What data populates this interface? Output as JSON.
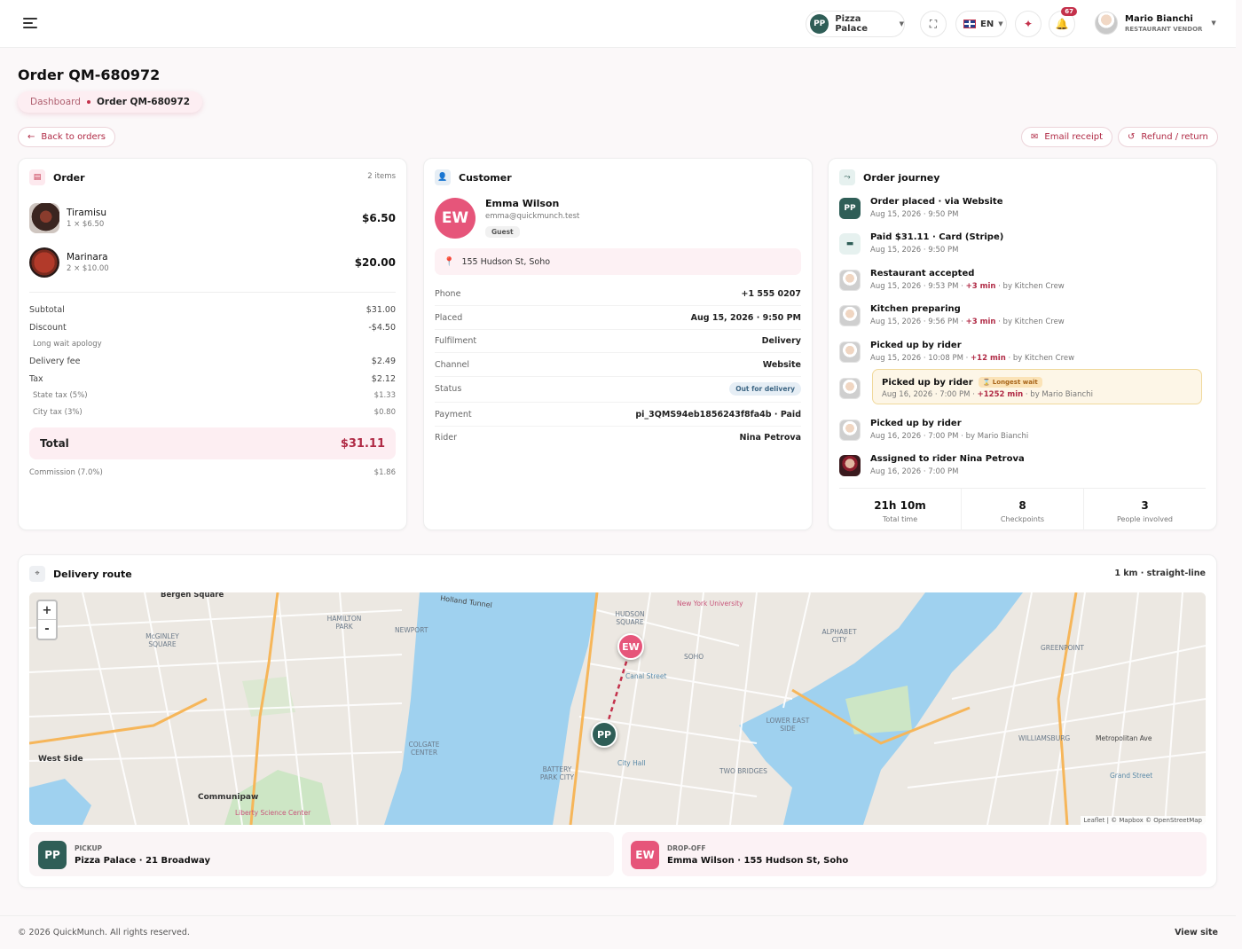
{
  "topbar": {
    "restaurant": {
      "initials": "PP",
      "name": "Pizza Palace"
    },
    "language": "EN",
    "notification_count": "67",
    "user": {
      "name": "Mario Bianchi",
      "role": "RESTAURANT VENDOR"
    }
  },
  "page": {
    "title": "Order QM-680972",
    "breadcrumb": {
      "root": "Dashboard",
      "current": "Order QM-680972"
    },
    "back_label": "Back to orders",
    "email_receipt_label": "Email receipt",
    "refund_label": "Refund / return"
  },
  "order": {
    "title": "Order",
    "count": "2 items",
    "items": [
      {
        "name": "Tiramisu",
        "qty": "1 × $6.50",
        "price": "$6.50"
      },
      {
        "name": "Marinara",
        "qty": "2 × $10.00",
        "price": "$20.00"
      }
    ],
    "summary": [
      {
        "label": "Subtotal",
        "value": "$31.00"
      },
      {
        "label": "Discount",
        "value": "-$4.50"
      },
      {
        "label": "Long wait apology",
        "value": ""
      },
      {
        "label": "Delivery fee",
        "value": "$2.49"
      },
      {
        "label": "Tax",
        "value": "$2.12"
      },
      {
        "label": "State tax (5%)",
        "value": "$1.33"
      },
      {
        "label": "City tax (3%)",
        "value": "$0.80"
      }
    ],
    "total_label": "Total",
    "total_value": "$31.11",
    "commission_label": "Commission (7.0%)",
    "commission_value": "$1.86"
  },
  "customer": {
    "title": "Customer",
    "initials": "EW",
    "name": "Emma Wilson",
    "email": "emma@quickmunch.test",
    "tag": "Guest",
    "address": "155 Hudson St, Soho",
    "details": [
      {
        "key": "Phone",
        "value": "+1 555 0207"
      },
      {
        "key": "Placed",
        "value": "Aug 15, 2026 · 9:50 PM"
      },
      {
        "key": "Fulfilment",
        "value": "Delivery"
      },
      {
        "key": "Channel",
        "value": "Website"
      },
      {
        "key": "Status",
        "value": "Out for delivery"
      },
      {
        "key": "Payment",
        "value": "pi_3QMS94eb1856243f8fa4b · Paid"
      },
      {
        "key": "Rider",
        "value": "Nina Petrova"
      }
    ]
  },
  "journey": {
    "title": "Order journey",
    "events": [
      {
        "title": "Order placed · via Website",
        "time": "Aug 15, 2026 · 9:50 PM",
        "delta": "",
        "by": ""
      },
      {
        "title": "Paid $31.11 · Card (Stripe)",
        "time": "Aug 15, 2026 · 9:50 PM",
        "delta": "",
        "by": ""
      },
      {
        "title": "Restaurant accepted",
        "time": "Aug 15, 2026 · 9:53 PM · ",
        "delta": "+3 min",
        "by": " · by Kitchen Crew"
      },
      {
        "title": "Kitchen preparing",
        "time": "Aug 15, 2026 · 9:56 PM · ",
        "delta": "+3 min",
        "by": " · by Kitchen Crew"
      },
      {
        "title": "Picked up by rider",
        "time": "Aug 15, 2026 · 10:08 PM · ",
        "delta": "+12 min",
        "by": " · by Kitchen Crew"
      },
      {
        "title": "Picked up by rider",
        "time": "Aug 16, 2026 · 7:00 PM · ",
        "delta": "+1252 min",
        "by": " · by Mario Bianchi",
        "badge": "Longest wait"
      },
      {
        "title": "Picked up by rider",
        "time": "Aug 16, 2026 · 7:00 PM · by Mario Bianchi",
        "delta": "",
        "by": ""
      },
      {
        "title": "Assigned to rider Nina Petrova",
        "time": "Aug 16, 2026 · 7:00 PM",
        "delta": "",
        "by": ""
      }
    ],
    "stats": [
      {
        "value": "21h 10m",
        "label": "Total time"
      },
      {
        "value": "8",
        "label": "Checkpoints"
      },
      {
        "value": "3",
        "label": "People involved"
      }
    ]
  },
  "route": {
    "title": "Delivery route",
    "distance": "1 km · straight-line",
    "zoom_in": "+",
    "zoom_out": "-",
    "attribution": "Leaflet | © Mapbox © OpenStreetMap",
    "pickup": {
      "label": "PICKUP",
      "initials": "PP",
      "value": "Pizza Palace · 21 Broadway"
    },
    "dropoff": {
      "label": "DROP-OFF",
      "initials": "EW",
      "value": "Emma Wilson · 155 Hudson St, Soho"
    },
    "map_labels": [
      "Bergen Square",
      "West Side",
      "Communipaw",
      "Holland Tunnel",
      "HUDSON SQUARE",
      "SOHO",
      "New York University",
      "ALPHABET CITY",
      "GREENPOINT",
      "WILLIAMSBURG",
      "LOWER EAST SIDE",
      "TWO BRIDGES",
      "COLGATE CENTER",
      "BATTERY PARK CITY",
      "NEWPORT",
      "HAMILTON PARK",
      "McGINLEY SQUARE",
      "Liberty Science Center",
      "Canal Street",
      "City Hall",
      "Metropolitan Ave",
      "Grand Street"
    ]
  },
  "colors": {
    "accent": "#c4314b",
    "brand_green": "#2f5e57",
    "dropoff_pink": "#e6557a"
  },
  "footer": {
    "copyright": "© 2026 QuickMunch. All rights reserved.",
    "view_site": "View site"
  }
}
